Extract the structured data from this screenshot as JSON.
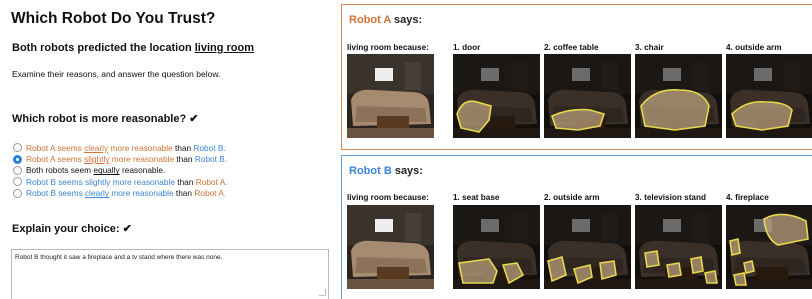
{
  "survey": {
    "title": "Which Robot Do You Trust?",
    "predicted_prefix": "Both robots predicted the location ",
    "predicted_location": "living room",
    "instructions": "Examine their reasons, and answer the question below.",
    "question": "Which robot is more reasonable? ✔",
    "options": [
      {
        "selected": false,
        "parts": [
          {
            "text": "Robot A seems ",
            "cls": "ca"
          },
          {
            "text": "clearly",
            "cls": "ca u"
          },
          {
            "text": " more reasonable ",
            "cls": "ca"
          },
          {
            "text": "than",
            "cls": ""
          },
          {
            "text": " Robot B.",
            "cls": "cb"
          }
        ]
      },
      {
        "selected": true,
        "parts": [
          {
            "text": "Robot A seems ",
            "cls": "ca"
          },
          {
            "text": "slightly",
            "cls": "ca u"
          },
          {
            "text": " more reasonable ",
            "cls": "ca"
          },
          {
            "text": "than",
            "cls": ""
          },
          {
            "text": " Robot B.",
            "cls": "cb"
          }
        ]
      },
      {
        "selected": false,
        "parts": [
          {
            "text": "Both robots seem ",
            "cls": ""
          },
          {
            "text": "equally",
            "cls": "u"
          },
          {
            "text": " reasonable.",
            "cls": ""
          }
        ]
      },
      {
        "selected": false,
        "parts": [
          {
            "text": "Robot B seems slightly more reasonable ",
            "cls": "cb"
          },
          {
            "text": "than",
            "cls": ""
          },
          {
            "text": " Robot A.",
            "cls": "ca"
          }
        ]
      },
      {
        "selected": false,
        "parts": [
          {
            "text": "Robot B seems ",
            "cls": "cb"
          },
          {
            "text": "clearly",
            "cls": "cb u"
          },
          {
            "text": " more reasonable ",
            "cls": "cb"
          },
          {
            "text": "than",
            "cls": ""
          },
          {
            "text": " Robot A.",
            "cls": "ca"
          }
        ]
      }
    ],
    "explain_label": "Explain your choice: ✔",
    "explain_value": "Robot B thought it saw a fireplace and a tv stand where there was none."
  },
  "robot_a": {
    "name": "Robot A",
    "says": " says:",
    "because": "living room because:",
    "reasons": [
      "1. door",
      "2. coffee table",
      "3. chair",
      "4. outside arm"
    ]
  },
  "robot_b": {
    "name": "Robot B",
    "says": " says:",
    "because": "living room because:",
    "reasons": [
      "1. seat base",
      "2. outside arm",
      "3. television stand",
      "4. fireplace"
    ]
  },
  "colors": {
    "robot_a": "#d07437",
    "robot_b": "#3a86d6",
    "highlight": "#e8d84a",
    "selected_radio": "#2a7fd8"
  }
}
